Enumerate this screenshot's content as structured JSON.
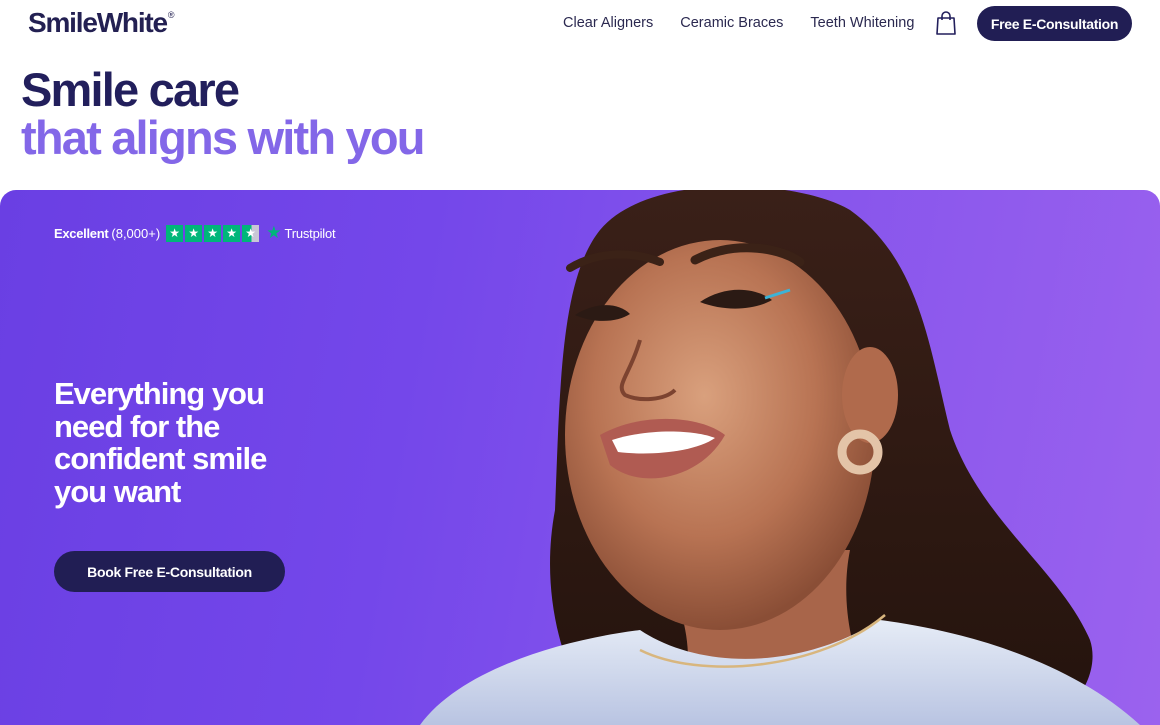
{
  "brand": {
    "name": "SmileWhite",
    "reg_mark": "®"
  },
  "nav": {
    "links": [
      "Clear Aligners",
      "Ceramic Braces",
      "Teeth Whitening"
    ],
    "cta_label": "Free E-Consultation"
  },
  "headline": {
    "line1": "Smile care",
    "line2": "that aligns with you"
  },
  "hero": {
    "trust": {
      "rating_label": "Excellent",
      "review_count": "(8,000+)",
      "stars": 4.5,
      "provider": "Trustpilot"
    },
    "title": "Everything you need for the confident smile you want",
    "cta_label": "Book Free E-Consultation"
  },
  "colors": {
    "navy": "#211e54",
    "accent_purple": "#8367e8",
    "hero_purple": "#7447ea",
    "trustpilot_green": "#00b67a"
  },
  "icons": {
    "cart": "shopping-bag-icon",
    "trust_star": "trustpilot-star-icon"
  }
}
